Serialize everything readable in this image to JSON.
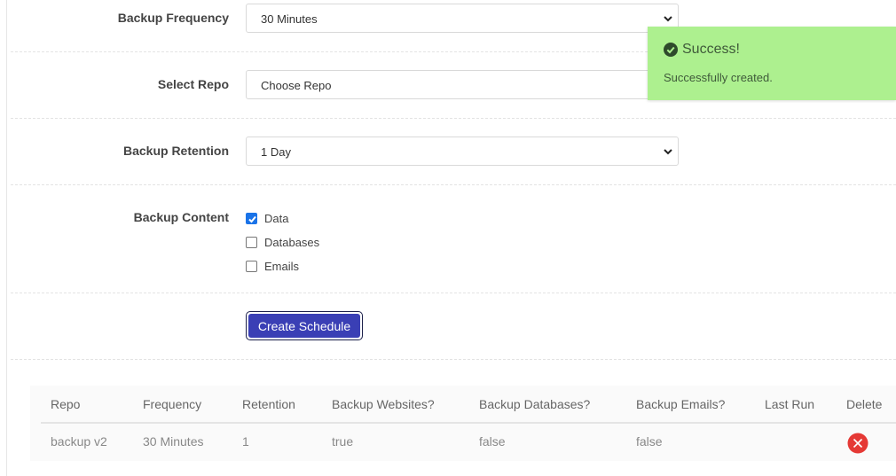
{
  "form": {
    "frequency": {
      "label": "Backup Frequency",
      "value": "30 Minutes"
    },
    "repo": {
      "label": "Select Repo",
      "value": "Choose Repo"
    },
    "retention": {
      "label": "Backup Retention",
      "value": "1 Day"
    },
    "content": {
      "label": "Backup Content",
      "options": [
        {
          "label": "Data",
          "checked": true
        },
        {
          "label": "Databases",
          "checked": false
        },
        {
          "label": "Emails",
          "checked": false
        }
      ]
    },
    "submit_label": "Create Schedule"
  },
  "table": {
    "headers": [
      "Repo",
      "Frequency",
      "Retention",
      "Backup Websites?",
      "Backup Databases?",
      "Backup Emails?",
      "Last Run",
      "Delete"
    ],
    "rows": [
      {
        "repo": "backup v2",
        "frequency": "30 Minutes",
        "retention": "1",
        "websites": "true",
        "databases": "false",
        "emails": "false",
        "last_run": "",
        "delete_icon": "delete-icon"
      }
    ]
  },
  "toast": {
    "title": "Success!",
    "message": "Successfully created.",
    "icon": "check-circle-icon",
    "color": "#adf08f"
  },
  "colors": {
    "accent": "#3a3fb5",
    "delete": "#e53935",
    "checkbox": "#1a73e8"
  }
}
